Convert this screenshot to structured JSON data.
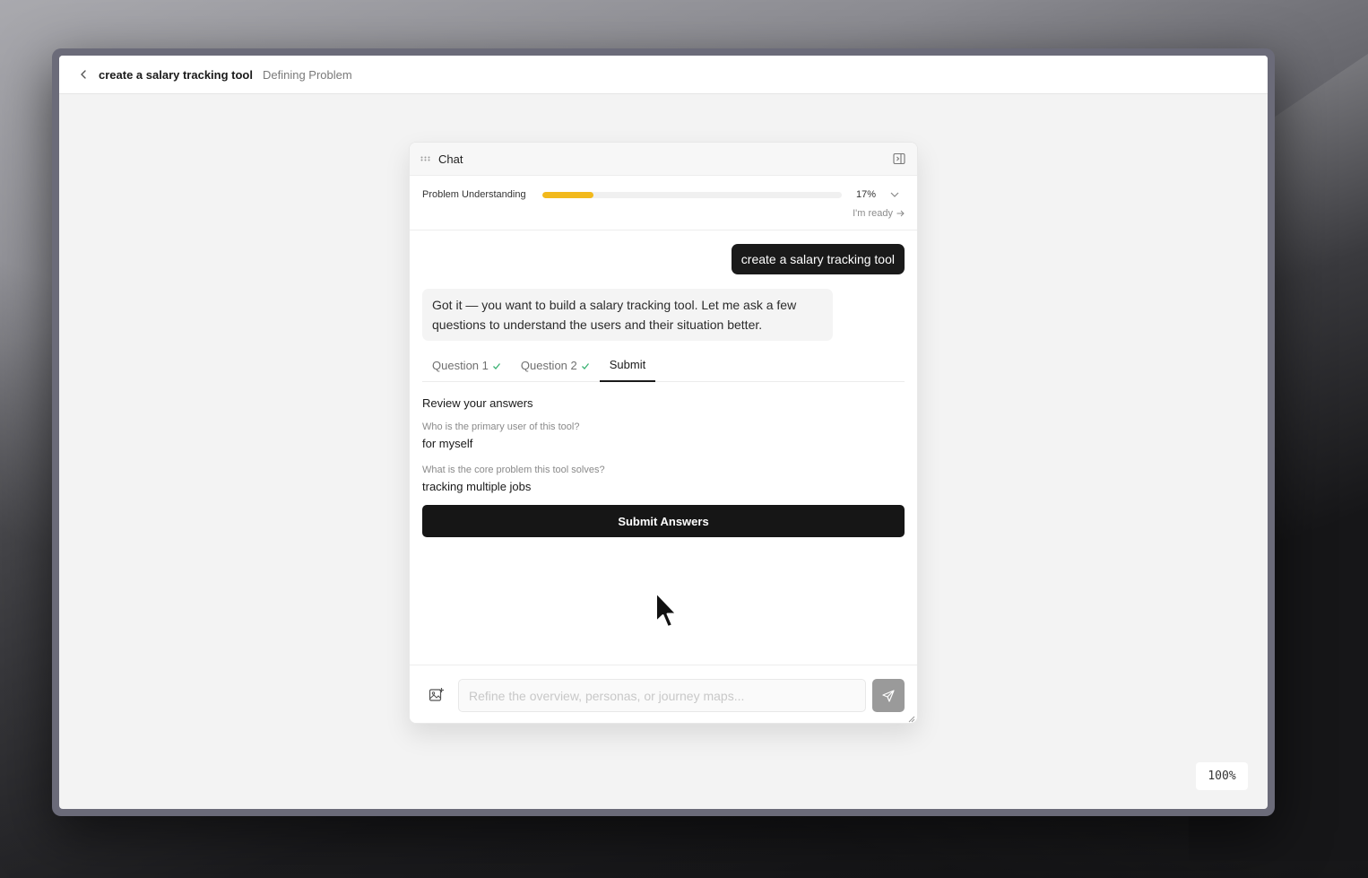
{
  "header": {
    "project_title": "create a salary tracking tool",
    "phase": "Defining Problem"
  },
  "chat": {
    "title": "Chat",
    "progress": {
      "label": "Problem Understanding",
      "percent_text": "17%",
      "percent": 17,
      "ready_label": "I'm ready",
      "fill_color": "#f2b91c"
    },
    "messages": {
      "user": "create a salary tracking tool",
      "assistant": "Got it — you want to build a salary tracking tool. Let me ask a few questions to understand the users and their situation better."
    },
    "tabs": [
      {
        "label": "Question 1",
        "done": true
      },
      {
        "label": "Question 2",
        "done": true
      },
      {
        "label": "Submit",
        "done": false
      }
    ],
    "review": {
      "title": "Review your answers",
      "items": [
        {
          "question": "Who is the primary user of this tool?",
          "answer": "for myself"
        },
        {
          "question": "What is the core problem this tool solves?",
          "answer": "tracking multiple jobs"
        }
      ]
    },
    "submit_label": "Submit Answers",
    "composer": {
      "placeholder": "Refine the overview, personas, or journey maps..."
    }
  },
  "zoom": "100%",
  "colors": {
    "accent_dark": "#1a1a1a",
    "check_green": "#3bb273"
  }
}
